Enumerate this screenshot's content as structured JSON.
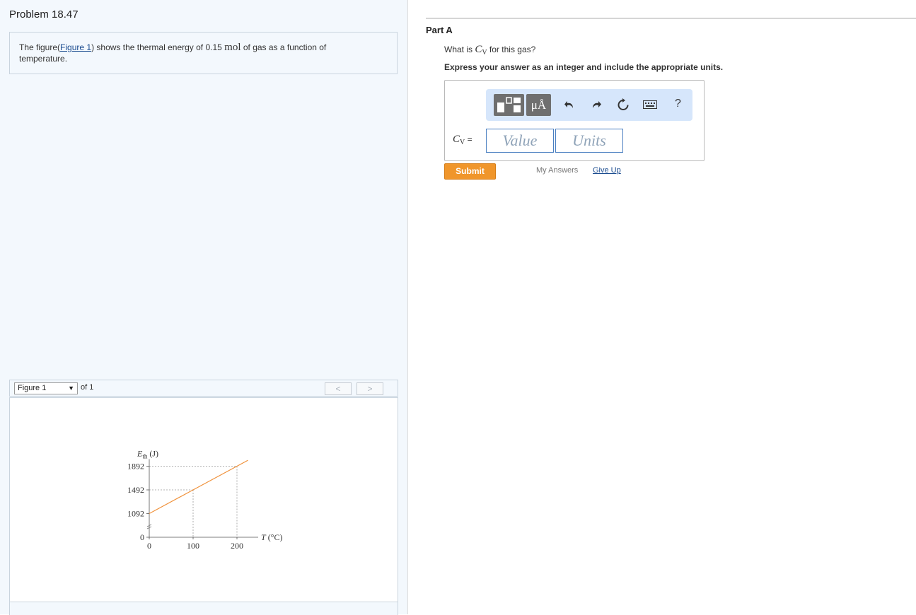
{
  "problem": {
    "title": "Problem 18.47",
    "intro_before_link": "The figure(",
    "intro_link": "Figure 1",
    "intro_after_link": ") shows the thermal energy of 0.15 ",
    "intro_mol": "mol",
    "intro_end": " of gas as a function of temperature."
  },
  "figure_nav": {
    "selected": "Figure 1",
    "of_label": "of 1",
    "prev": "<",
    "next": ">"
  },
  "chart_data": {
    "type": "line",
    "ylabel_main": "E",
    "ylabel_sub": "th",
    "ylabel_unit": " (J)",
    "xlabel": "T (°C)",
    "x_ticks": [
      0,
      100,
      200
    ],
    "y_ticks": [
      0,
      1092,
      1492,
      1892
    ],
    "y_axis_break": true,
    "series": [
      {
        "x": [
          0,
          100,
          200
        ],
        "y": [
          1092,
          1492,
          1892
        ]
      }
    ],
    "guides": [
      {
        "x": 100,
        "y": 1492
      },
      {
        "x": 200,
        "y": 1892
      }
    ],
    "line_color": "#f0913a"
  },
  "part": {
    "title": "Part A",
    "question_before": "What is ",
    "symbol_main": "C",
    "symbol_sub": "V",
    "question_after": " for this gas?",
    "instruction": "Express your answer as an integer and include the appropriate units."
  },
  "answer": {
    "label_main": "C",
    "label_sub": "V",
    "label_eq": " =",
    "value_placeholder": "Value",
    "units_placeholder": "Units",
    "toolbar": {
      "units_button": "μÅ",
      "help": "?"
    }
  },
  "actions": {
    "submit": "Submit",
    "my_answers": "My Answers",
    "give_up": "Give Up"
  }
}
